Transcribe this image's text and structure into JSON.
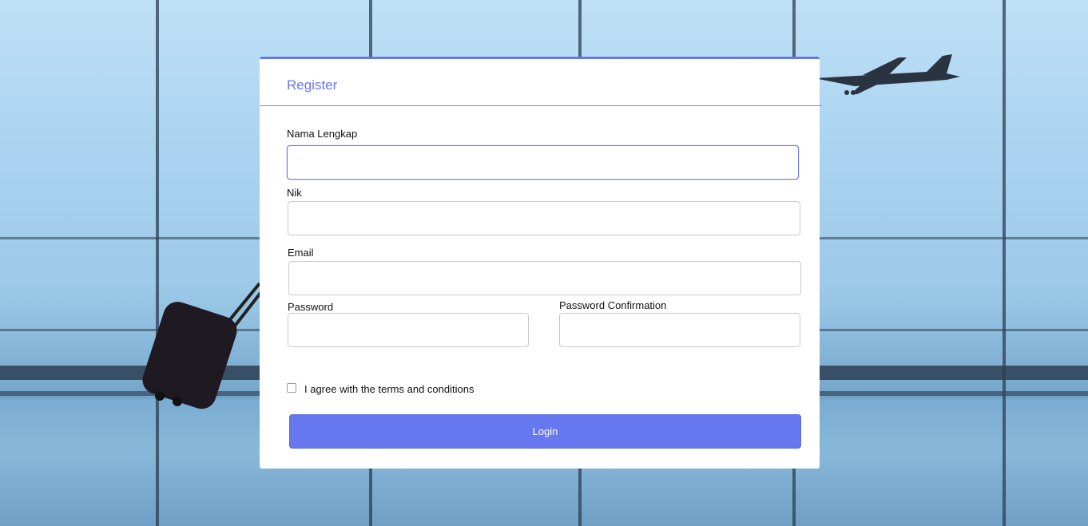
{
  "register": {
    "title": "Register",
    "fields": {
      "full_name": {
        "label": "Nama Lengkap",
        "value": "",
        "placeholder": ""
      },
      "nik": {
        "label": "Nik",
        "value": "",
        "placeholder": ""
      },
      "email": {
        "label": "Email",
        "value": "",
        "placeholder": ""
      },
      "password": {
        "label": "Password",
        "value": "",
        "placeholder": ""
      },
      "password_confirmation": {
        "label": "Password Confirmation",
        "value": "",
        "placeholder": ""
      }
    },
    "terms_label": "I agree with the terms and conditions",
    "terms_checked": false,
    "submit_label": "Login"
  },
  "colors": {
    "accent": "#6777ef",
    "card_background": "#ffffff",
    "text": "#111111"
  },
  "background": {
    "scene": "airport-window-background"
  }
}
